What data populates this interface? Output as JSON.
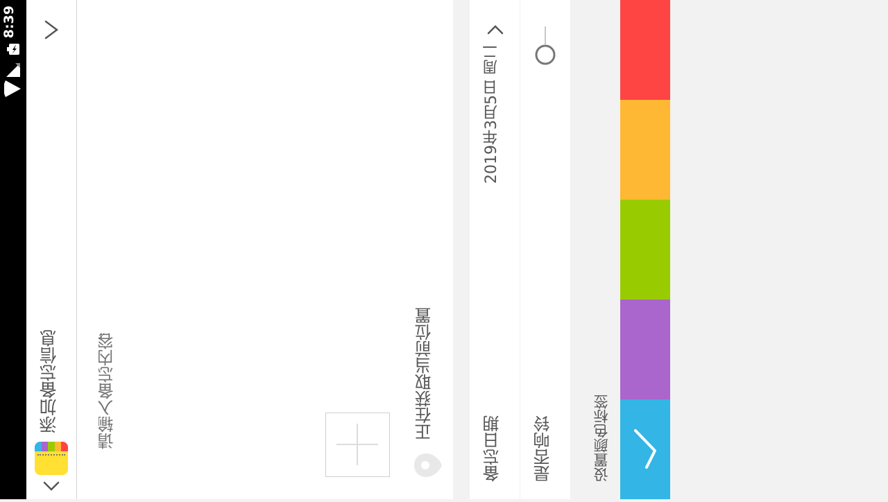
{
  "status_bar": {
    "time": "8:39",
    "icons": [
      "wifi-icon",
      "signal-icon",
      "battery-charging-icon"
    ]
  },
  "header": {
    "title": "添加备忘信息",
    "back_icon": "chevron-down-icon",
    "next_icon": "chevron-right-icon",
    "app_icon": "notepad-app-icon"
  },
  "memo": {
    "placeholder": "请输入备忘内容",
    "value": "",
    "add_photo_icon": "plus-icon"
  },
  "location": {
    "text": "正在获取当前位置",
    "icon": "location-pin-icon"
  },
  "date_setting": {
    "label": "备忘日期",
    "value": "2019年3月5日 周二",
    "icon": "chevron-right-icon"
  },
  "ring_setting": {
    "label": "是否响铃",
    "enabled": false,
    "icon": "toggle-switch-icon"
  },
  "color_setting": {
    "label": "设置颜色标签",
    "swatches": [
      "#ff4444",
      "#ffb833",
      "#99cc00",
      "#aa66cc",
      "#33b5e5"
    ],
    "selected_index": 4,
    "selected_icon": "check-chevron-icon"
  }
}
